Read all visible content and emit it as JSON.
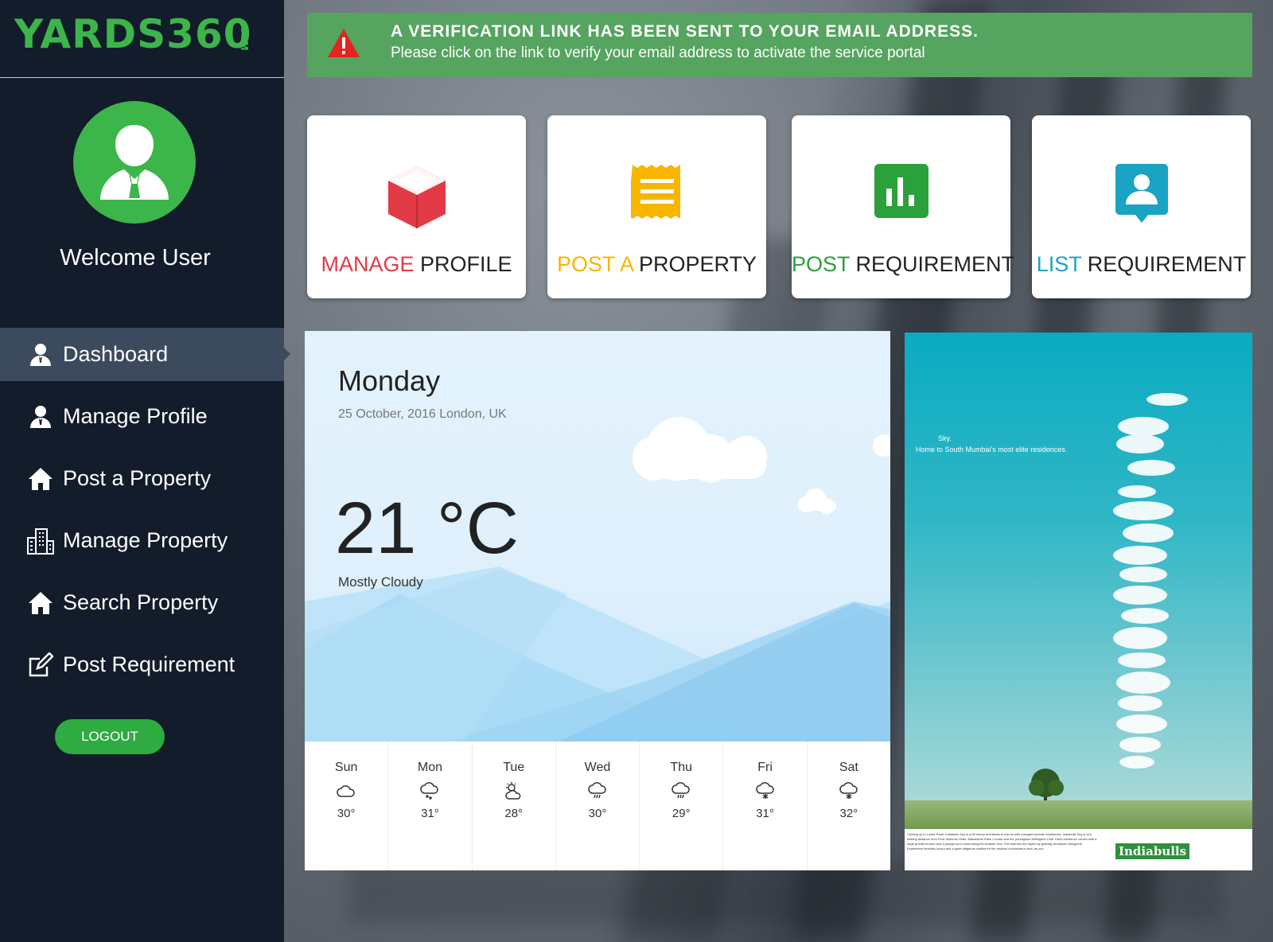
{
  "brand": {
    "logo": "YARDS360",
    "logo_suffix": ".COM",
    "ad_brand": "Indiabulls"
  },
  "sidebar": {
    "welcome": "Welcome User",
    "items": [
      {
        "label": "Dashboard",
        "icon": "user-icon",
        "active": true
      },
      {
        "label": "Manage Profile",
        "icon": "user-icon"
      },
      {
        "label": "Post a Property",
        "icon": "home-icon"
      },
      {
        "label": "Manage Property",
        "icon": "building-icon"
      },
      {
        "label": "Search Property",
        "icon": "home-icon"
      },
      {
        "label": "Post Requirement",
        "icon": "edit-icon"
      }
    ],
    "logout": "LOGOUT"
  },
  "alert": {
    "title": "A VERIFICATION LINK HAS BEEN SENT TO YOUR EMAIL ADDRESS.",
    "message": "Please click on the link to verify your email address to activate the service portal"
  },
  "tiles": [
    {
      "accent": "MANAGE",
      "rest": " PROFILE",
      "color": "#e23a47",
      "icon": "cube-icon"
    },
    {
      "accent": "POST A",
      "rest": " PROPERTY",
      "color": "#f7b500",
      "icon": "receipt-icon"
    },
    {
      "accent": "POST",
      "rest": " REQUIREMENT",
      "color": "#2aa13a",
      "icon": "bar-chart-icon"
    },
    {
      "accent": "LIST",
      "rest": " REQUIREMENT",
      "color": "#1aa3c2",
      "icon": "contact-icon"
    }
  ],
  "weather": {
    "day": "Monday",
    "date": "25 October, 2016 London, UK",
    "temp": "21 °C",
    "condition": "Mostly Cloudy",
    "forecast": [
      {
        "day": "Sun",
        "temp": "30°",
        "icon": "cloud-icon"
      },
      {
        "day": "Mon",
        "temp": "31°",
        "icon": "snow-cloud-icon"
      },
      {
        "day": "Tue",
        "temp": "28°",
        "icon": "partly-sunny-icon"
      },
      {
        "day": "Wed",
        "temp": "30°",
        "icon": "rain-cloud-icon"
      },
      {
        "day": "Thu",
        "temp": "29°",
        "icon": "rain-cloud-icon"
      },
      {
        "day": "Fri",
        "temp": "31°",
        "icon": "snow-cloud-icon"
      },
      {
        "day": "Sat",
        "temp": "32°",
        "icon": "snow-cloud-icon"
      }
    ]
  },
  "ad": {
    "line1": "Sky.",
    "line2": "Home to South Mumbai's most elite residences.",
    "fine_print": "Coming up in Lower Parel, Indiabulls Sky is a 65 storey architectural marvel with managed private residences. Indiabulls Sky is at a striking distance from Four Seasons Hotel, Mahalaxmi Race Course and the prestigious Willingdon Club. Each residence comes with a large private terrace and a plunge pool overlooking the Arabian Sea. The interiors are styled by globally acclaimed designers. Experience timeless luxury and a quiet elegance crafted for the modern connoisseur such as you."
  }
}
